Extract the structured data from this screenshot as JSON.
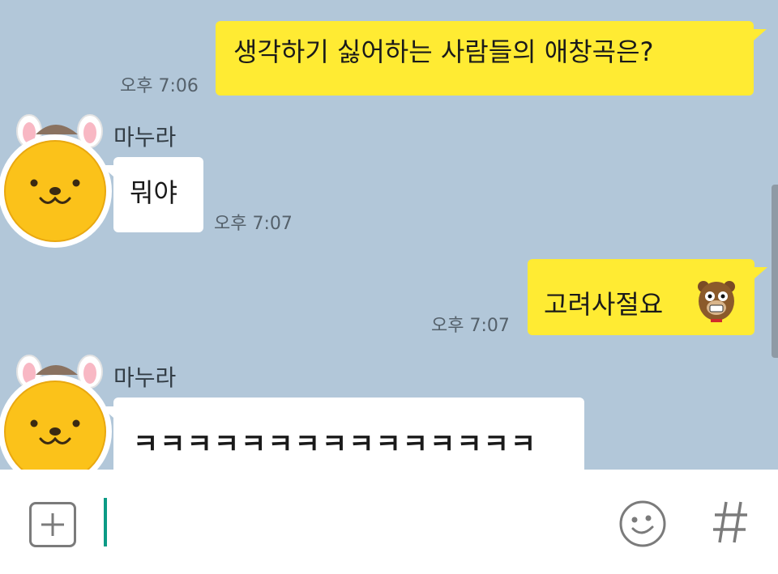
{
  "messages": [
    {
      "side": "mine",
      "text": "생각하기 싫어하는 사람들의 애창곡은?",
      "time": "오후 7:06"
    },
    {
      "side": "theirs",
      "sender": "마누라",
      "text": "뭐야",
      "time": "오후 7:07"
    },
    {
      "side": "mine",
      "text": "고려사절요",
      "sticker": "bear-emoticon",
      "time": "오후 7:07"
    },
    {
      "side": "theirs",
      "sender": "마누라",
      "text": "ㅋㅋㅋㅋㅋㅋㅋㅋㅋㅋㅋㅋㅋㅋㅋ"
    }
  ],
  "input": {
    "value": "",
    "icons": [
      "add-icon",
      "emoticon-icon",
      "hashtag-icon"
    ]
  },
  "colors": {
    "chat_background": "#b2c7d9",
    "my_bubble": "#ffeb33",
    "their_bubble": "#ffffff",
    "cursor": "#0c9b86"
  }
}
